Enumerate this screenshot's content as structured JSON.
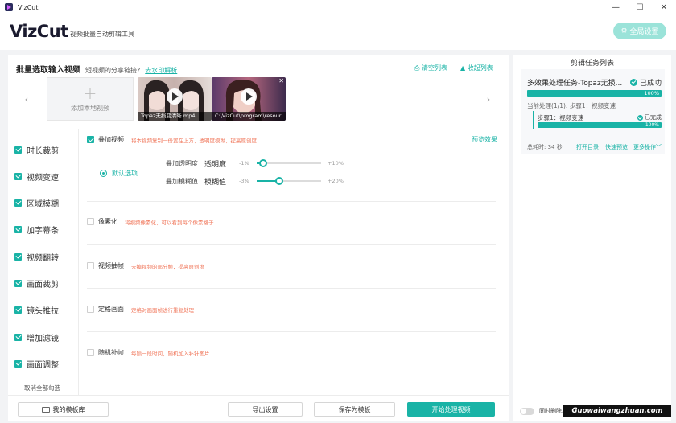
{
  "window": {
    "title": "VizCut",
    "minimize": "—",
    "maximize": "☐",
    "close": "✕"
  },
  "header": {
    "logo": "VizCut",
    "tagline": "视频批量自动剪辑工具",
    "settings_label": "全局设置"
  },
  "input": {
    "title": "批量选取输入视频",
    "share_question": "短视频的分享链接?",
    "share_link": "去水印解析",
    "clear_list": "清空列表",
    "collapse_list": "收起列表",
    "add_local": "添加本地视频",
    "videos": [
      {
        "caption": "Topaz无损变清晰.mp4"
      },
      {
        "caption": "C:\\VizCut\\program\\resour..."
      }
    ]
  },
  "sidebar": {
    "items": [
      {
        "label": "时长裁剪",
        "checked": true
      },
      {
        "label": "视频变速",
        "checked": true
      },
      {
        "label": "区域模糊",
        "checked": true
      },
      {
        "label": "加字幕条",
        "checked": true
      },
      {
        "label": "视频翻转",
        "checked": true
      },
      {
        "label": "画面裁剪",
        "checked": true
      },
      {
        "label": "镜头推拉",
        "checked": true
      },
      {
        "label": "增加滤镜",
        "checked": true
      },
      {
        "label": "画面调整",
        "checked": true
      }
    ],
    "deselect_all": "取消全部勾选"
  },
  "overlay_section": {
    "title": "叠加视频",
    "desc": "将本视频复制一份置在上方，透明度模糊，提高原创度",
    "preview": "预览效果",
    "option": "默认选项",
    "opacity": {
      "label": "叠加透明度",
      "name": "透明度",
      "min": "-1%",
      "max": "+10%",
      "value_fraction": 0.1
    },
    "blur": {
      "label": "叠加模糊值",
      "name": "模糊值",
      "min": "-3%",
      "max": "+20%",
      "value_fraction": 0.35
    }
  },
  "sections": [
    {
      "title": "像素化",
      "desc": "将视频像素化，可以看到每个像素格子"
    },
    {
      "title": "视频抽帧",
      "desc": "去掉视频的部分帧，提高原创度"
    },
    {
      "title": "定格画面",
      "desc": "定格对画面帧进行重复处理"
    },
    {
      "title": "随机补帧",
      "desc": "每隔一段时间，随机加入补针图片"
    }
  ],
  "bottom": {
    "template_lib": "我的模板库",
    "export_settings": "导出设置",
    "save_template": "保存为模板",
    "start": "开始处理视频"
  },
  "task_panel": {
    "title": "剪辑任务列表",
    "task_name": "多效果处理任务-Topaz无损...",
    "status": "已成功",
    "progress_label": "100%",
    "current": "当前处理(1/1): 步骤1：视频变速",
    "step": "步骤1：视频变速",
    "step_status": "已完成",
    "step_progress": "100%",
    "elapsed": "总耗时: 34 秒",
    "open_dir": "打开目录",
    "quick_preview": "快速预览",
    "more_ops": "更多操作",
    "toggle_label": "同时删除本地任"
  },
  "watermark": "Guowaiwangzhuan.com",
  "colors": {
    "accent": "#19b3a6",
    "desc": "#f0765a"
  }
}
